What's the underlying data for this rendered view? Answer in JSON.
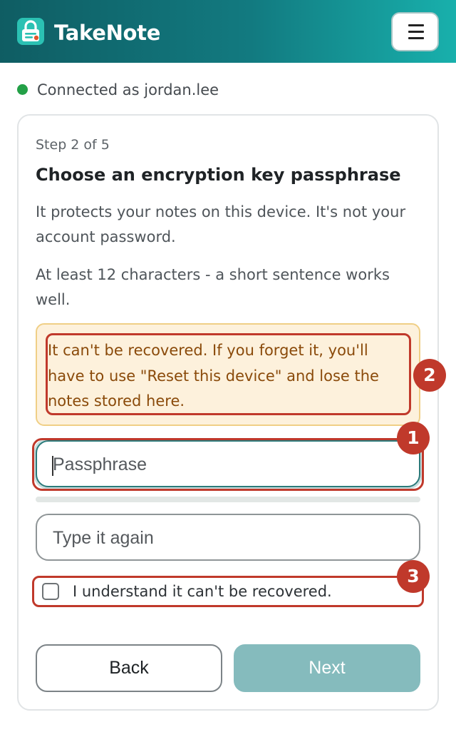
{
  "app": {
    "title": "TakeNote",
    "brand_gradient": [
      "#0f5d63",
      "#18b0ac"
    ],
    "logo_icon": "lock-note-icon",
    "menu_icon": "hamburger-menu-icon"
  },
  "status": {
    "text": "Connected as jordan.lee",
    "dot_color": "#23a047"
  },
  "wizard": {
    "step": "Step 2 of 5",
    "heading": "Choose an encryption key passphrase",
    "description": "It protects your notes on this device. It's not your account password.",
    "hint": "At least 12 characters - a short sentence works well.",
    "warning": "It can't be recovered. If you forget it, you'll have to use \"Reset this device\" and lose the notes stored here.",
    "passphrase": {
      "value": "",
      "placeholder": "Passphrase"
    },
    "confirm": {
      "value": "",
      "placeholder": "Type it again"
    },
    "checkbox": {
      "label": "I understand it can't be recovered.",
      "checked": false
    },
    "buttons": {
      "back": "Back",
      "next": "Next"
    }
  },
  "annotations": [
    {
      "number": "1",
      "target": "passphrase-input"
    },
    {
      "number": "2",
      "target": "warning-box"
    },
    {
      "number": "3",
      "target": "understand-checkbox-row"
    }
  ],
  "colors": {
    "accent": "#2b7a7a",
    "next_disabled": "#85bbbd",
    "warning_bg": "#fdf1dc",
    "warning_text": "#8a4a0a",
    "annotation": "#c0392b"
  }
}
